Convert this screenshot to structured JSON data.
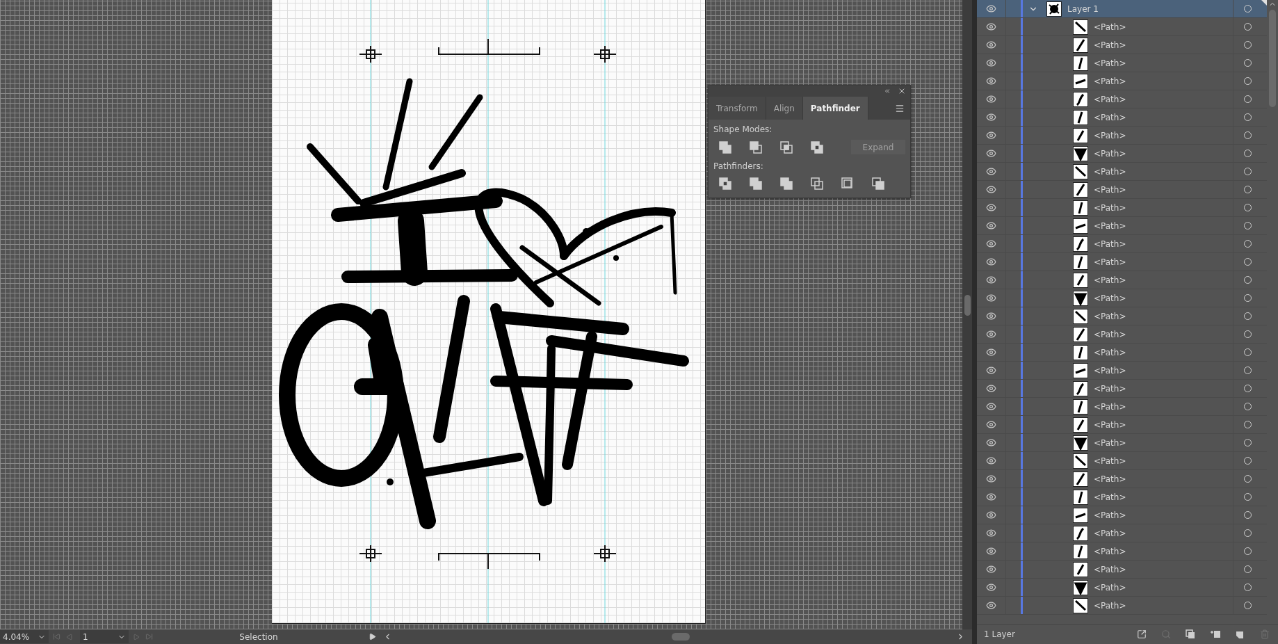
{
  "pathfinder_panel": {
    "tabs": [
      {
        "label": "Transform",
        "selected": false
      },
      {
        "label": "Align",
        "selected": false
      },
      {
        "label": "Pathfinder",
        "selected": true
      }
    ],
    "shape_modes_label": "Shape Modes:",
    "expand_button": {
      "label": "Expand",
      "disabled": true
    },
    "pathfinders_label": "Pathfinders:"
  },
  "status_bar": {
    "zoom": "4.04%",
    "page": "1",
    "tool": "Selection"
  },
  "layers_panel": {
    "layers": [
      {
        "name": "Layer 1",
        "visible": true,
        "expanded": true,
        "selected": true,
        "children": [
          {
            "name": "<Path>",
            "visible": true
          },
          {
            "name": "<Path>",
            "visible": true
          },
          {
            "name": "<Path>",
            "visible": true
          },
          {
            "name": "<Path>",
            "visible": true
          },
          {
            "name": "<Path>",
            "visible": true
          },
          {
            "name": "<Path>",
            "visible": true
          },
          {
            "name": "<Path>",
            "visible": true
          },
          {
            "name": "<Path>",
            "visible": true
          },
          {
            "name": "<Path>",
            "visible": true
          },
          {
            "name": "<Path>",
            "visible": true
          },
          {
            "name": "<Path>",
            "visible": true
          },
          {
            "name": "<Path>",
            "visible": true
          },
          {
            "name": "<Path>",
            "visible": true
          },
          {
            "name": "<Path>",
            "visible": true
          },
          {
            "name": "<Path>",
            "visible": true
          },
          {
            "name": "<Path>",
            "visible": true
          },
          {
            "name": "<Path>",
            "visible": true
          },
          {
            "name": "<Path>",
            "visible": true
          },
          {
            "name": "<Path>",
            "visible": true
          },
          {
            "name": "<Path>",
            "visible": true
          },
          {
            "name": "<Path>",
            "visible": true
          },
          {
            "name": "<Path>",
            "visible": true
          },
          {
            "name": "<Path>",
            "visible": true
          },
          {
            "name": "<Path>",
            "visible": true
          },
          {
            "name": "<Path>",
            "visible": true
          },
          {
            "name": "<Path>",
            "visible": true
          },
          {
            "name": "<Path>",
            "visible": true
          },
          {
            "name": "<Path>",
            "visible": true
          },
          {
            "name": "<Path>",
            "visible": true
          },
          {
            "name": "<Path>",
            "visible": true
          },
          {
            "name": "<Path>",
            "visible": true
          },
          {
            "name": "<Path>",
            "visible": true
          },
          {
            "name": "<Path>",
            "visible": true
          }
        ]
      }
    ],
    "footer": "1 Layer"
  }
}
